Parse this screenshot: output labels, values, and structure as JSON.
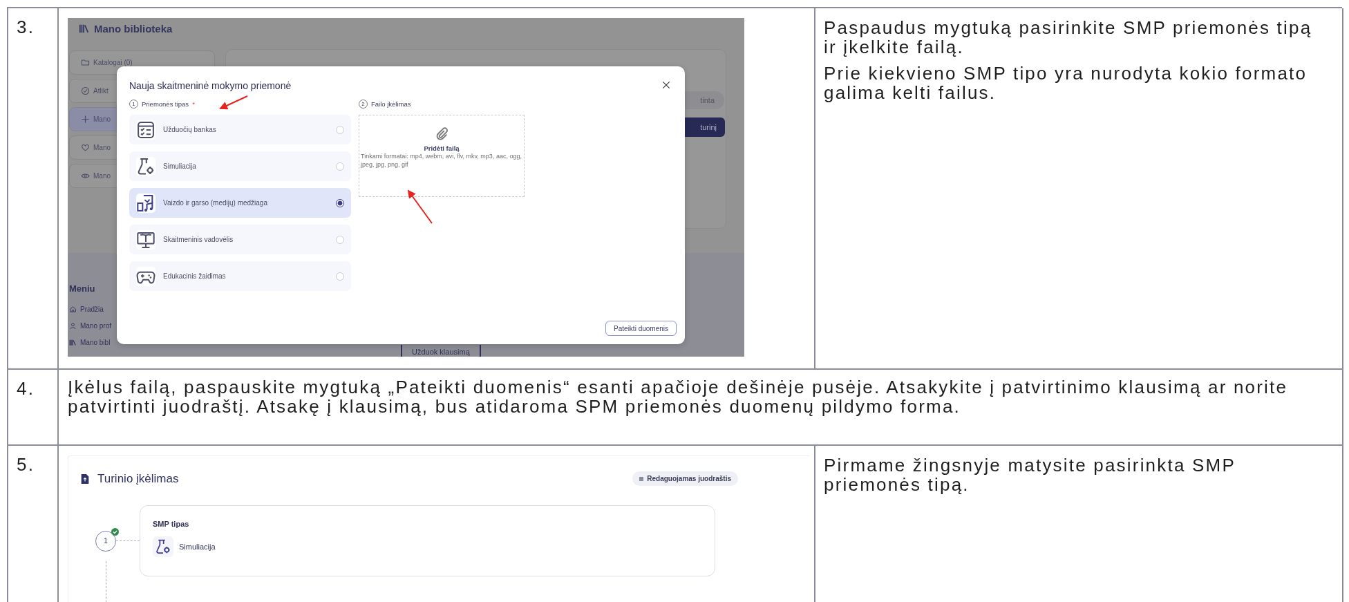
{
  "rows": [
    {
      "number": "3.",
      "kind": "library",
      "screenshot": {
        "page_title": "Mano biblioteka",
        "sidebar": [
          {
            "label": "Katalogai (0)",
            "selected": false
          },
          {
            "label": "Atlikt",
            "selected": false
          },
          {
            "label": "Mano",
            "selected": true
          },
          {
            "label": "Mano",
            "selected": false
          },
          {
            "label": "Mano",
            "selected": false
          }
        ],
        "status_pill": "tinta",
        "action_button": "turinį",
        "menu": {
          "title": "Meniu",
          "items": [
            {
              "label": "Pradžia"
            },
            {
              "label": "Mano prof"
            },
            {
              "label": "Mano bibl"
            }
          ]
        },
        "help_button": "Užduok klausimą",
        "modal": {
          "title": "Nauja skaitmeninė mokymo priemonė",
          "steps": [
            {
              "number": "1",
              "label": "Priemonės tipas",
              "required_mark": "*"
            },
            {
              "number": "2",
              "label": "Failo įkėlimas"
            }
          ],
          "types": [
            {
              "label": "Užduočių bankas",
              "selected": false
            },
            {
              "label": "Simuliacija",
              "selected": false
            },
            {
              "label": "Vaizdo ir garso (medijų) medžiaga",
              "selected": true
            },
            {
              "label": "Skaitmeninis vadovėlis",
              "selected": false
            },
            {
              "label": "Edukacinis žaidimas",
              "selected": false
            }
          ],
          "upload": {
            "title": "Pridėti failą",
            "formats": "Tinkami formatai: mp4, webm, avi, flv, mkv, mp3, aac, ogg, jpeg, jpg, png, gif"
          },
          "submit": "Pateikti duomenis"
        }
      },
      "notes": [
        "Paspaudus mygtuką pasirinkite SMP priemonės tipą ir įkelkite failą.",
        "Prie kiekvieno SMP tipo yra nurodyta kokio formato galima kelti failus."
      ]
    },
    {
      "number": "4.",
      "kind": "text",
      "text": "Įkėlus failą, paspauskite mygtuką „Pateikti duomenis“ esanti apačioje dešinėje pusėje. Atsakykite į patvirtinimo klausimą ar norite patvirtinti juodraštį. Atsakę į klausimą, bus atidaroma SPM priemonės duomenų pildymo forma."
    },
    {
      "number": "5.",
      "kind": "upload",
      "screenshot": {
        "title": "Turinio įkėlimas",
        "status": "Redaguojamas juodraštis",
        "steps": [
          {
            "number": "1",
            "done": true,
            "heading": "SMP tipas",
            "value": "Simuliacija"
          }
        ]
      },
      "notes": [
        "Pirmame žingsnyje matysite pasirinkta SMP priemonės tipą."
      ]
    }
  ]
}
